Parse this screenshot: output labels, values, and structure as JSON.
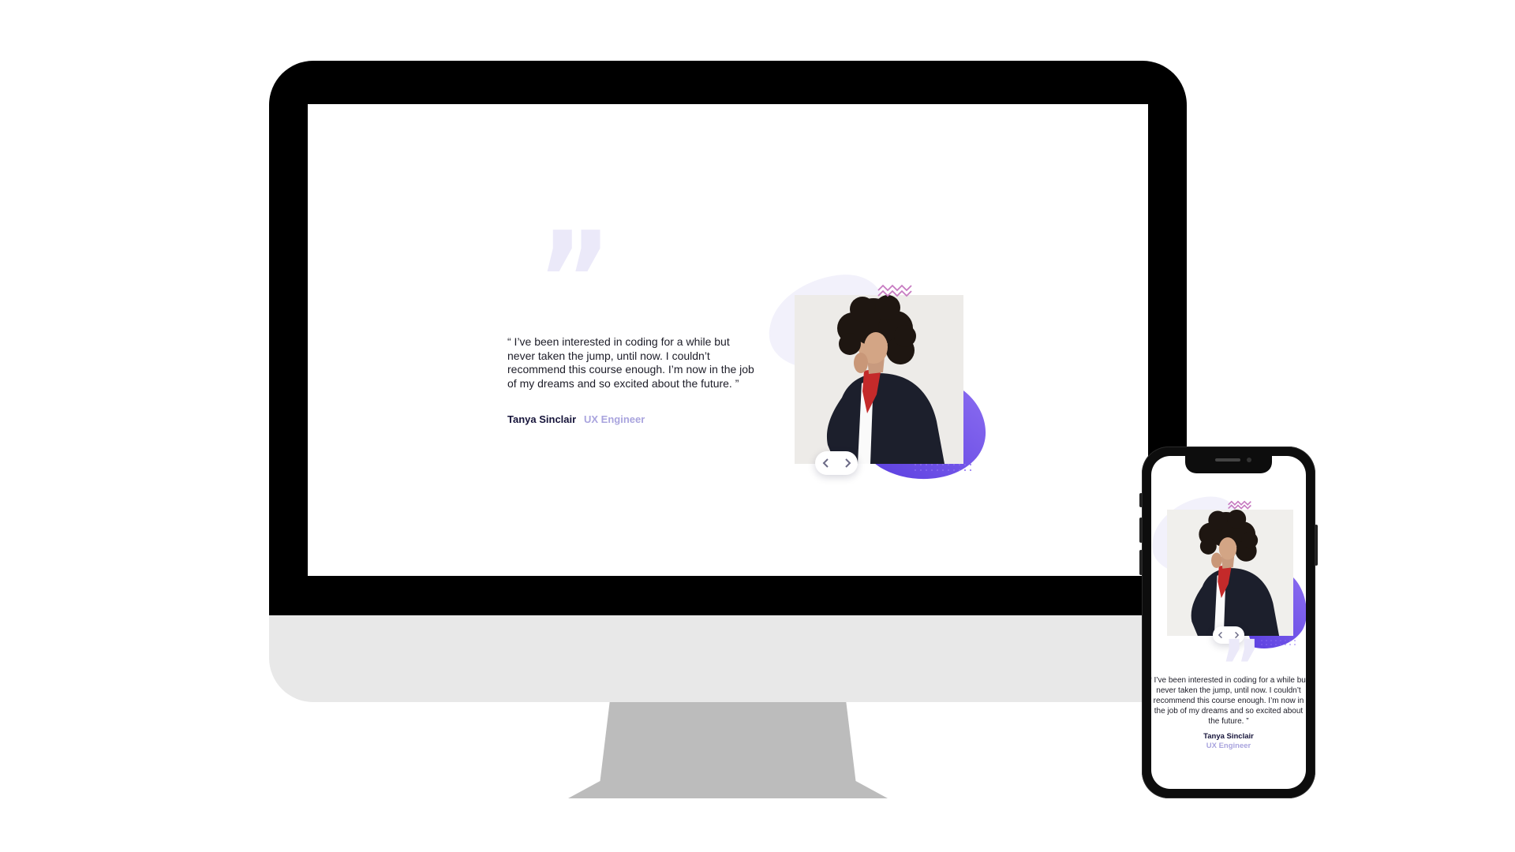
{
  "testimonial": {
    "quote": "“ I’ve been interested in coding for a while but never taken the jump, until now. I couldn’t recommend this course enough. I’m now in the job of my dreams and so excited about the future. ”",
    "name": "Tanya Sinclair",
    "role": "UX Engineer",
    "quote_glyph": "”",
    "photo_icon": "portrait-photo",
    "nav": {
      "prev_icon": "chevron-left-icon",
      "next_icon": "chevron-right-icon"
    }
  },
  "colors": {
    "background": "#ffffff",
    "text": "#1d1d28",
    "name": "#16143a",
    "role": "#a9a4de",
    "accent_blob": "#6f52e6",
    "accent_blob_light": "#8a6cf0",
    "zigzag": "#c77bc1",
    "quote_mark": "#ebe9f9",
    "soft_blob": "#f2f1fb",
    "monitor_frame": "#000000",
    "monitor_chin": "#e8e8e8",
    "monitor_stand": "#bcbcbc",
    "phone_body": "#0d0d0d"
  }
}
